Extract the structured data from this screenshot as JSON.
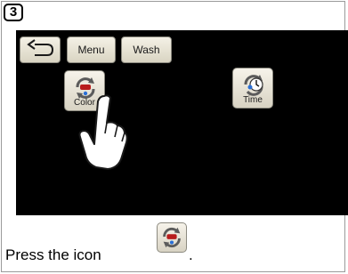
{
  "step": {
    "number": "3"
  },
  "toolbar": {
    "back_icon": "back-arrow-icon",
    "menu_label": "Menu",
    "wash_label": "Wash"
  },
  "screen": {
    "buttons": [
      {
        "label": "Color",
        "icon": "color-refresh-icon"
      },
      {
        "label": "Time",
        "icon": "time-refresh-icon"
      }
    ],
    "pointer_icon": "hand-pointer-icon"
  },
  "caption": {
    "text": "Press the icon",
    "inline_icon": "color-refresh-icon",
    "end": "."
  },
  "colors": {
    "screen_bg": "#000000",
    "button_bg": "#e6e2d4",
    "accent_red": "#b81c1c",
    "accent_blue": "#2a6fd6"
  }
}
